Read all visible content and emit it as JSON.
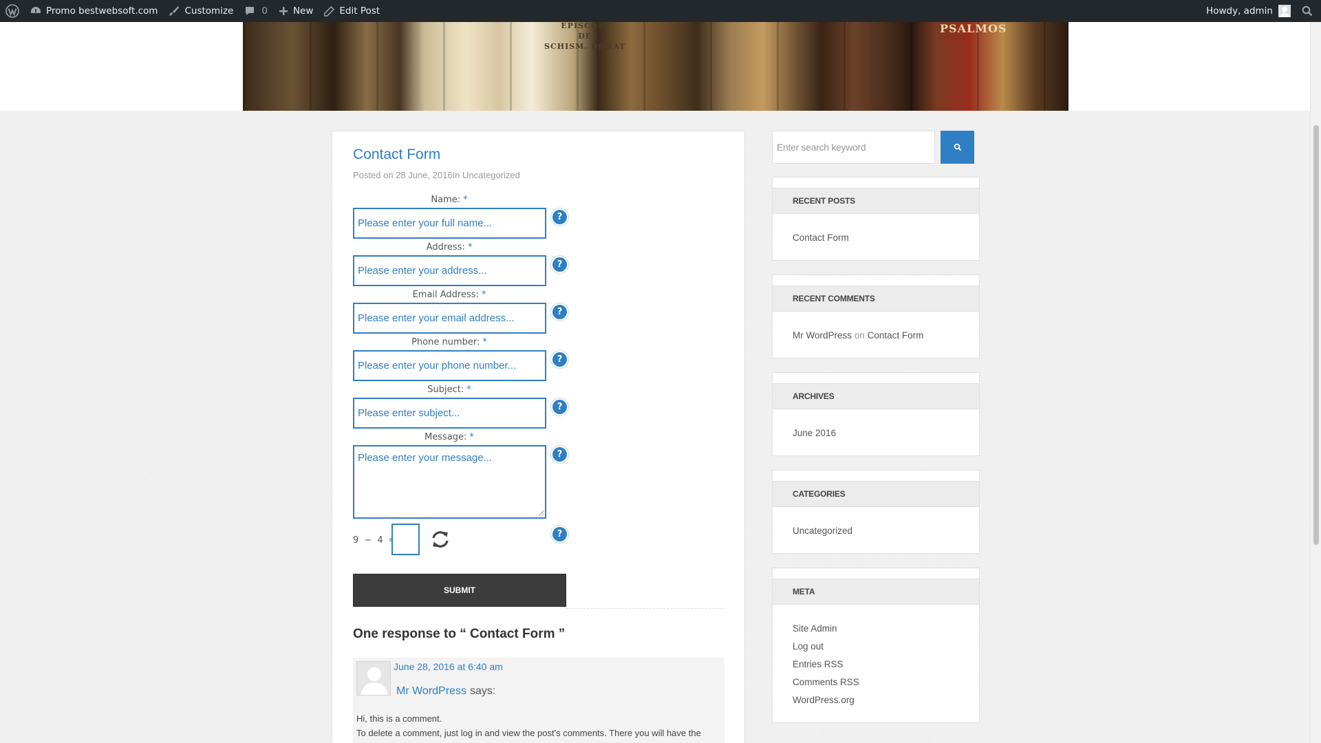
{
  "adminbar": {
    "site_name": "Promo bestwebsoft.com",
    "customize": "Customize",
    "comments_count": "0",
    "new": "New",
    "edit_post": "Edit Post",
    "howdy": "Howdy, admin"
  },
  "header": {
    "book_text_1": "EPISCOPI\nDE\nSCHISM. DONAT",
    "book_text_2": "PSALMOS"
  },
  "post": {
    "title": "Contact Form",
    "meta_prefix": "Posted on ",
    "meta_date": "28 June, 2016",
    "meta_in": "In ",
    "meta_category": "Uncategorized"
  },
  "form": {
    "fields": [
      {
        "label": "Name:",
        "placeholder": "Please enter your full name..."
      },
      {
        "label": "Address:",
        "placeholder": "Please enter your address..."
      },
      {
        "label": "Email Address:",
        "placeholder": "Please enter your email address..."
      },
      {
        "label": "Phone number:",
        "placeholder": "Please enter your phone number..."
      },
      {
        "label": "Subject:",
        "placeholder": "Please enter subject..."
      },
      {
        "label": "Message:",
        "placeholder": "Please enter your message..."
      }
    ],
    "required_mark": "*",
    "help_glyph": "?",
    "captcha_expression": "9 − 4 =",
    "submit_label": "SUBMIT"
  },
  "comments": {
    "title": "One response to “ Contact Form ”",
    "items": [
      {
        "date": "June 28, 2016 at 6:40 am",
        "author": "Mr WordPress",
        "says": "says:",
        "line1": "Hi, this is a comment.",
        "line2": "To delete a comment, just log in and view the post's comments. There you will have the"
      }
    ]
  },
  "sidebar": {
    "search_placeholder": "Enter search keyword",
    "recent_posts": {
      "title": "RECENT POSTS",
      "items": [
        "Contact Form"
      ]
    },
    "recent_comments": {
      "title": "RECENT COMMENTS",
      "author": "Mr WordPress",
      "on": "on",
      "post": "Contact Form"
    },
    "archives": {
      "title": "ARCHIVES",
      "items": [
        "June 2016"
      ]
    },
    "categories": {
      "title": "CATEGORIES",
      "items": [
        "Uncategorized"
      ]
    },
    "meta": {
      "title": "META",
      "items": [
        "Site Admin",
        "Log out",
        "Entries RSS",
        "Comments RSS",
        "WordPress.org"
      ]
    }
  },
  "colors": {
    "accent": "#2e7fc3",
    "adminbar": "#23282d",
    "submit": "#3c3c3c"
  }
}
